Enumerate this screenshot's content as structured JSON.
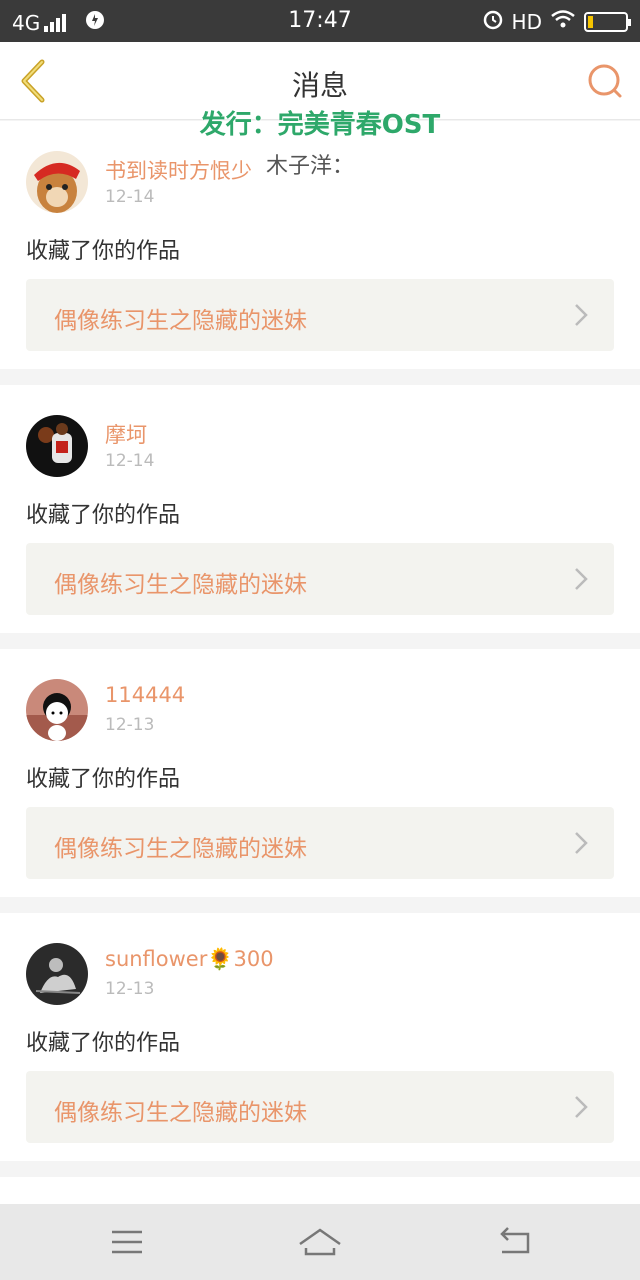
{
  "status_bar": {
    "network": "4G",
    "time": "17:47",
    "hd": "HD",
    "battery_level": 0.15
  },
  "header": {
    "title": "消息",
    "back_icon": "chevron-left-icon",
    "search_icon": "search-icon"
  },
  "overlay": {
    "line1": "发行：完美青春OST",
    "line2": "木子洋："
  },
  "messages": [
    {
      "username": "书到读时方恨少",
      "date": "12-14",
      "action": "收藏了你的作品",
      "work_title": "偶像练习生之隐藏的迷妹"
    },
    {
      "username": "摩坷",
      "date": "12-14",
      "action": "收藏了你的作品",
      "work_title": "偶像练习生之隐藏的迷妹"
    },
    {
      "username": "114444",
      "date": "12-13",
      "action": "收藏了你的作品",
      "work_title": "偶像练习生之隐藏的迷妹"
    },
    {
      "username": "sunflower🌻300",
      "date": "12-13",
      "action": "收藏了你的作品",
      "work_title": "偶像练习生之隐藏的迷妹"
    }
  ],
  "colors": {
    "accent": "#e9956a",
    "back_icon": "#c9a227",
    "lyric_green": "#2ea86a"
  },
  "bottom_nav": [
    "menu-icon",
    "home-icon",
    "back-icon"
  ]
}
